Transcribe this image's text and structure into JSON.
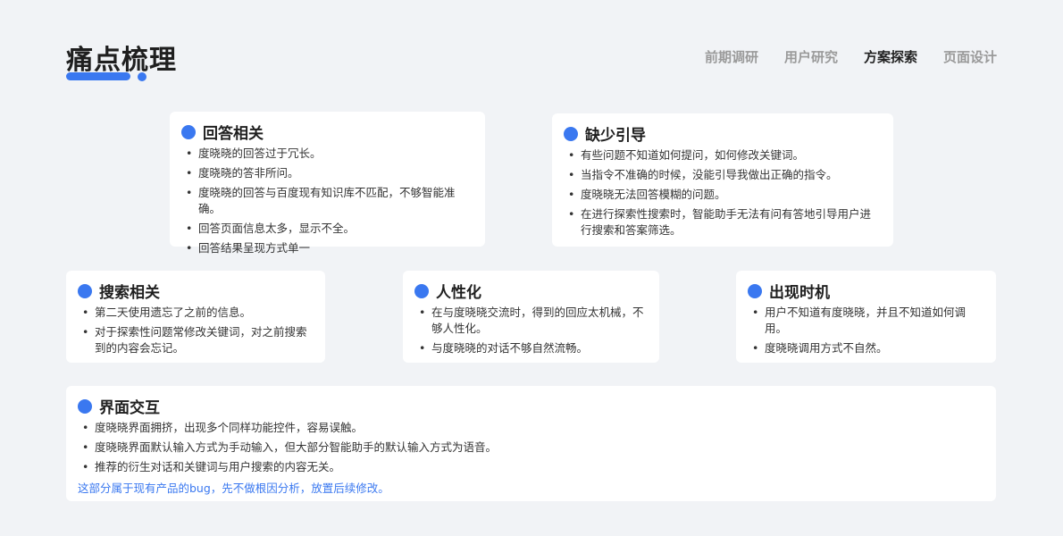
{
  "header": {
    "title": "痛点梳理",
    "nav": [
      "前期调研",
      "用户研究",
      "方案探索",
      "页面设计"
    ],
    "active_nav": "方案探索"
  },
  "cards": {
    "answer": {
      "title": "回答相关",
      "items": [
        "度晓晓的回答过于冗长。",
        "度晓晓的答非所问。",
        "度晓晓的回答与百度现有知识库不匹配，不够智能准确。",
        "回答页面信息太多，显示不全。",
        "回答结果呈现方式单一"
      ]
    },
    "guide": {
      "title": "缺少引导",
      "items": [
        "有些问题不知道如何提问，如何修改关键词。",
        "当指令不准确的时候，没能引导我做出正确的指令。",
        "度晓晓无法回答模糊的问题。",
        "在进行探索性搜索时，智能助手无法有问有答地引导用户进行搜索和答案筛选。"
      ]
    },
    "search": {
      "title": "搜索相关",
      "items": [
        "第二天使用遗忘了之前的信息。",
        "对于探索性问题常修改关键词，对之前搜索到的内容会忘记。"
      ]
    },
    "humanize": {
      "title": "人性化",
      "items": [
        "在与度晓晓交流时，得到的回应太机械，不够人性化。",
        "与度晓晓的对话不够自然流畅。"
      ]
    },
    "timing": {
      "title": "出现时机",
      "items": [
        "用户不知道有度晓晓，并且不知道如何调用。",
        "度晓晓调用方式不自然。"
      ]
    },
    "interface": {
      "title": "界面交互",
      "items": [
        "度晓晓界面拥挤，出现多个同样功能控件，容易误触。",
        "度晓晓界面默认输入方式为手动输入，但大部分智能助手的默认输入方式为语音。",
        "推荐的衍生对话和关键词与用户搜索的内容无关。"
      ],
      "note": "这部分属于现有产品的bug，先不做根因分析，放置后续修改。"
    }
  },
  "colors": {
    "accent": "#3a78f0",
    "background": "#f1f3f6",
    "card": "#ffffff"
  }
}
